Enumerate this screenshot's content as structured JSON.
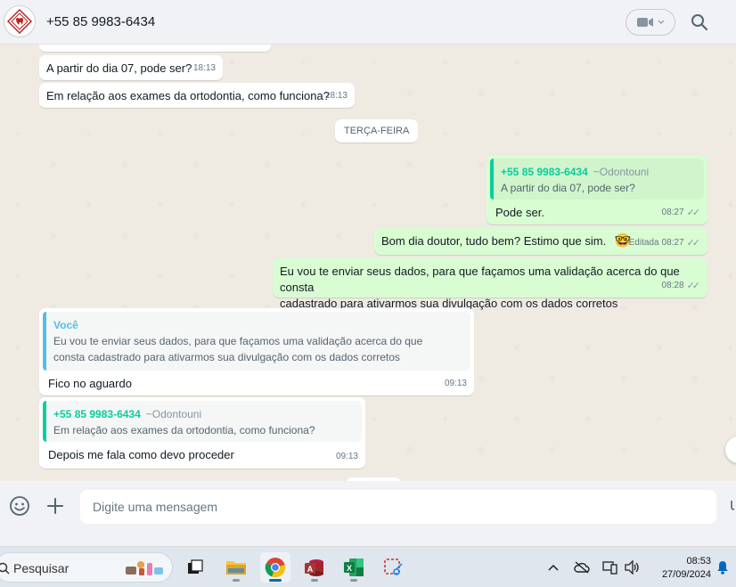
{
  "header": {
    "contact_name": "+55 85 9983-6434"
  },
  "chat": {
    "day_separator": "TERÇA-FEIRA",
    "messages": [
      {
        "text": "A partir do dia 07, pode ser?",
        "time": "18:13"
      },
      {
        "text": "Em relação aos exames da ortodontia, como funciona?",
        "time": "18:13"
      },
      {
        "quote_name": "+55 85 9983-6434",
        "quote_alias": "~Odontouni",
        "quote_text": "A partir do dia 07, pode ser?",
        "text": "Pode ser.",
        "time": "08:27"
      },
      {
        "text": "Bom dia doutor, tudo bem? Estimo que sim.",
        "emoji": "🤓",
        "edited_label": "Editada",
        "time": "08:27"
      },
      {
        "text_line1": "Eu vou te enviar seus dados, para que façamos uma validação acerca do que consta",
        "text_line2": "cadastrado para ativarmos sua divulgação com os dados corretos",
        "time": "08:28"
      },
      {
        "quote_name": "Você",
        "quote_line1": "Eu vou te enviar seus dados, para que façamos uma validação acerca do que",
        "quote_line2": "consta cadastrado para ativarmos sua divulgação com os dados corretos",
        "text": "Fico no aguardo",
        "time": "09:13"
      },
      {
        "quote_name": "+55 85 9983-6434",
        "quote_alias": "~Odontouni",
        "quote_text": "Em relação aos exames da ortodontia, como funciona?",
        "text": "Depois me fala como devo proceder",
        "time": "09:13"
      }
    ]
  },
  "composer": {
    "placeholder": "Digite uma mensagem"
  },
  "taskbar": {
    "search_label": "Pesquisar",
    "time": "08:53",
    "date": "27/09/2024"
  },
  "colors": {
    "incoming": "#ffffff",
    "outgoing": "#d9fdd3",
    "quote_accent": "#06cf9c",
    "self_quote_accent": "#53bdeb",
    "background": "#efeae2"
  }
}
